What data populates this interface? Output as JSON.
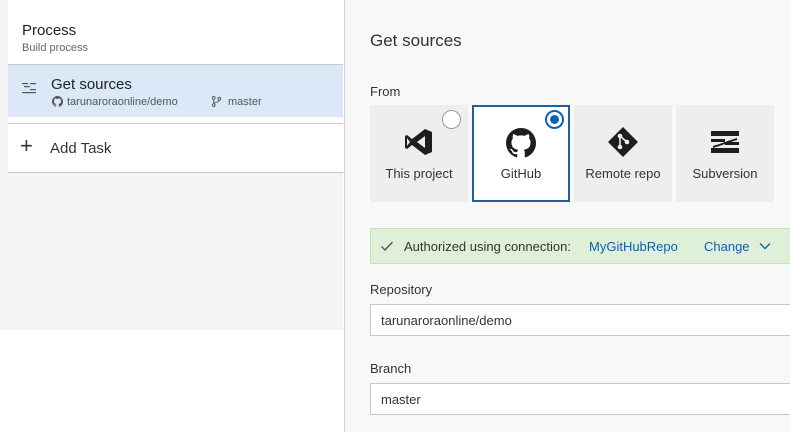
{
  "process": {
    "title": "Process",
    "subtitle": "Build process"
  },
  "tasks": {
    "get_sources": {
      "title": "Get sources",
      "repo": "tarunaroraonline/demo",
      "branch": "master"
    },
    "add_task_label": "Add Task"
  },
  "panel": {
    "title": "Get sources",
    "from_label": "From",
    "sources": [
      {
        "label": "This project",
        "icon": "visual-studio-icon",
        "selected": false
      },
      {
        "label": "GitHub",
        "icon": "github-icon",
        "selected": true
      },
      {
        "label": "Remote repo",
        "icon": "git-icon",
        "selected": false
      },
      {
        "label": "Subversion",
        "icon": "subversion-icon",
        "selected": false
      }
    ],
    "auth": {
      "text": "Authorized using connection:",
      "connection": "MyGitHubRepo",
      "change_label": "Change"
    },
    "repository": {
      "label": "Repository",
      "value": "tarunaroraonline/demo"
    },
    "branch": {
      "label": "Branch",
      "value": "master"
    }
  },
  "colors": {
    "accent": "#0b5fb5",
    "selected_item_bg": "#dae8f7",
    "auth_bg": "#dff0d8"
  }
}
